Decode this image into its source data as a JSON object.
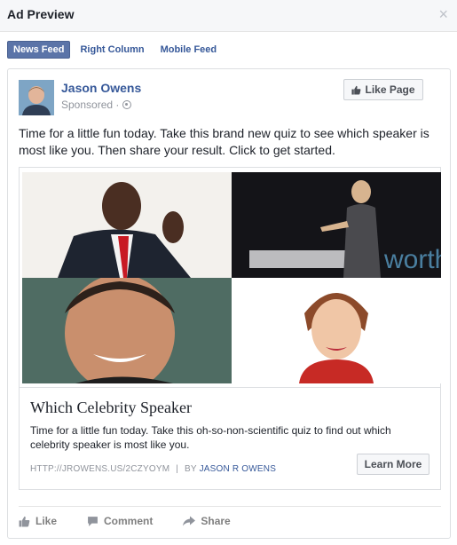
{
  "dialog": {
    "title": "Ad Preview",
    "close_icon": "×"
  },
  "tabs": [
    {
      "label": "News Feed",
      "active": true
    },
    {
      "label": "Right Column",
      "active": false
    },
    {
      "label": "Mobile Feed",
      "active": false
    }
  ],
  "post": {
    "author": "Jason Owens",
    "sponsored": "Sponsored ·",
    "like_page": "Like Page",
    "text": "Time for a little fun today. Take this brand new quiz to see which speaker is most like you. Then share your result. Click to get started.",
    "card": {
      "title": "Which Celebrity Speaker",
      "description": "Time for a little fun today. Take this oh-so-non-scientific quiz to find out which celebrity speaker is most like you.",
      "url": "HTTP://JROWENS.US/2CZYOYM",
      "separator": "|",
      "by_prefix": "BY",
      "by_author": "JASON R OWENS",
      "cta": "Learn More",
      "image_text": "worth"
    },
    "actions": {
      "like": "Like",
      "comment": "Comment",
      "share": "Share"
    }
  },
  "colors": {
    "link": "#365899",
    "tab_active_bg": "#5b74a8",
    "muted": "#90949c"
  }
}
